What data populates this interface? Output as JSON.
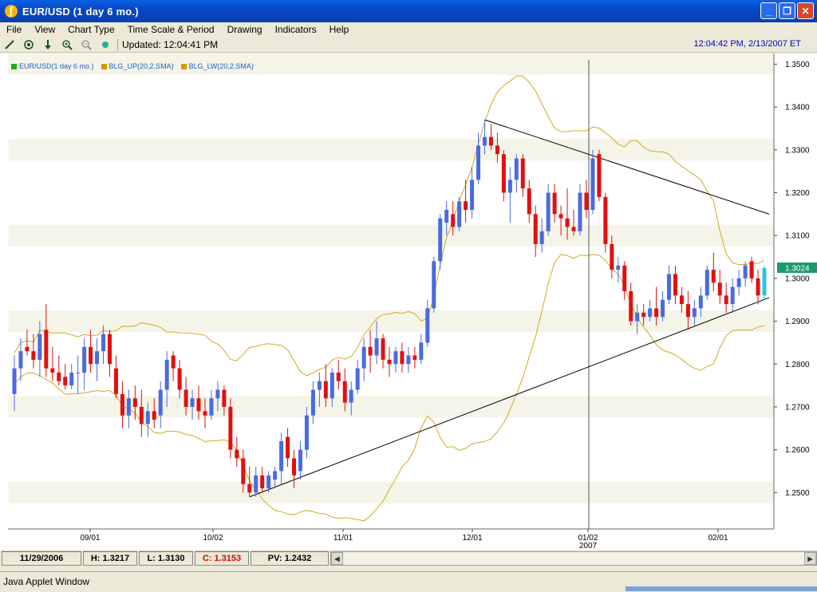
{
  "window": {
    "title": "EUR/USD (1  day  6 mo.)",
    "buttons": [
      "_",
      "❐",
      "✕"
    ]
  },
  "menu": [
    "File",
    "View",
    "Chart Type",
    "Time Scale & Period",
    "Drawing",
    "Indicators",
    "Help"
  ],
  "toolbar": {
    "icons": [
      "line-tool-icon",
      "crosshair-icon",
      "arrow-down-icon",
      "zoom-in-icon",
      "zoom-out-icon",
      "color-dot-icon"
    ],
    "updated": "Updated: 12:04:41 PM",
    "clock": "12:04:42 PM, 2/13/2007 ET"
  },
  "legend": [
    {
      "label": "EUR/USD(1 day 6 mo.)",
      "color": "#22aa22"
    },
    {
      "label": "BLG_UP(20,2,SMA)",
      "color": "#c8a000"
    },
    {
      "label": "BLG_LW(20,2,SMA)",
      "color": "#c8a000"
    }
  ],
  "status": {
    "date": "11/29/2006",
    "high": "H: 1.3217",
    "low": "L: 1.3130",
    "close": "C: 1.3153",
    "pv": "PV: 1.2432"
  },
  "java_bar": "Java Applet Window",
  "chart_data": {
    "type": "candlestick",
    "y_ticks": [
      "1.3500",
      "1.3400",
      "1.3300",
      "1.3200",
      "1.3100",
      "1.3000",
      "1.2900",
      "1.2800",
      "1.2700",
      "1.2600",
      "1.2500"
    ],
    "x_ticks": [
      "09/01",
      "10/02",
      "11/01",
      "12/01",
      "01/02",
      "02/01"
    ],
    "x_subticks": [
      "",
      "",
      "",
      "",
      "2007",
      ""
    ],
    "last_price": "1.3024",
    "ylim": [
      1.2415,
      1.3525
    ],
    "colors": {
      "up": "#4a6ae0",
      "down": "#e01010",
      "band": "#d4a820",
      "last": "#1a9a70",
      "trend": "#000000",
      "stripe": "#f5f4e8"
    },
    "candles": [
      [
        1.273,
        1.282,
        1.269,
        1.279
      ],
      [
        1.279,
        1.286,
        1.276,
        1.283
      ],
      [
        1.284,
        1.288,
        1.282,
        1.283
      ],
      [
        1.283,
        1.287,
        1.279,
        1.281
      ],
      [
        1.281,
        1.29,
        1.277,
        1.287
      ],
      [
        1.288,
        1.294,
        1.277,
        1.279
      ],
      [
        1.279,
        1.284,
        1.276,
        1.278
      ],
      [
        1.278,
        1.282,
        1.275,
        1.276
      ],
      [
        1.277,
        1.28,
        1.274,
        1.275
      ],
      [
        1.275,
        1.28,
        1.274,
        1.278
      ],
      [
        1.278,
        1.282,
        1.273,
        1.278
      ],
      [
        1.278,
        1.286,
        1.274,
        1.284
      ],
      [
        1.284,
        1.288,
        1.278,
        1.28
      ],
      [
        1.28,
        1.286,
        1.276,
        1.283
      ],
      [
        1.283,
        1.289,
        1.28,
        1.287
      ],
      [
        1.287,
        1.288,
        1.277,
        1.28
      ],
      [
        1.279,
        1.282,
        1.272,
        1.273
      ],
      [
        1.273,
        1.276,
        1.265,
        1.268
      ],
      [
        1.268,
        1.274,
        1.265,
        1.272
      ],
      [
        1.272,
        1.275,
        1.267,
        1.27
      ],
      [
        1.27,
        1.274,
        1.263,
        1.266
      ],
      [
        1.266,
        1.271,
        1.263,
        1.269
      ],
      [
        1.269,
        1.272,
        1.265,
        1.267
      ],
      [
        1.268,
        1.276,
        1.265,
        1.274
      ],
      [
        1.274,
        1.283,
        1.27,
        1.281
      ],
      [
        1.282,
        1.283,
        1.276,
        1.279
      ],
      [
        1.279,
        1.281,
        1.272,
        1.274
      ],
      [
        1.274,
        1.277,
        1.268,
        1.27
      ],
      [
        1.27,
        1.274,
        1.267,
        1.272
      ],
      [
        1.272,
        1.275,
        1.267,
        1.269
      ],
      [
        1.269,
        1.272,
        1.265,
        1.268
      ],
      [
        1.268,
        1.274,
        1.267,
        1.272
      ],
      [
        1.272,
        1.276,
        1.269,
        1.274
      ],
      [
        1.274,
        1.275,
        1.268,
        1.27
      ],
      [
        1.27,
        1.272,
        1.258,
        1.26
      ],
      [
        1.26,
        1.263,
        1.256,
        1.258
      ],
      [
        1.258,
        1.26,
        1.25,
        1.252
      ],
      [
        1.252,
        1.256,
        1.249,
        1.25
      ],
      [
        1.25,
        1.256,
        1.249,
        1.254
      ],
      [
        1.254,
        1.256,
        1.25,
        1.251
      ],
      [
        1.251,
        1.255,
        1.25,
        1.254
      ],
      [
        1.253,
        1.256,
        1.251,
        1.255
      ],
      [
        1.255,
        1.264,
        1.252,
        1.262
      ],
      [
        1.263,
        1.265,
        1.256,
        1.258
      ],
      [
        1.258,
        1.26,
        1.251,
        1.254
      ],
      [
        1.255,
        1.262,
        1.253,
        1.26
      ],
      [
        1.26,
        1.27,
        1.258,
        1.268
      ],
      [
        1.268,
        1.276,
        1.266,
        1.274
      ],
      [
        1.274,
        1.278,
        1.27,
        1.276
      ],
      [
        1.276,
        1.28,
        1.27,
        1.272
      ],
      [
        1.272,
        1.279,
        1.27,
        1.278
      ],
      [
        1.278,
        1.281,
        1.274,
        1.276
      ],
      [
        1.276,
        1.279,
        1.269,
        1.271
      ],
      [
        1.271,
        1.276,
        1.268,
        1.274
      ],
      [
        1.274,
        1.281,
        1.273,
        1.279
      ],
      [
        1.279,
        1.286,
        1.276,
        1.284
      ],
      [
        1.284,
        1.288,
        1.278,
        1.282
      ],
      [
        1.282,
        1.29,
        1.28,
        1.286
      ],
      [
        1.286,
        1.287,
        1.279,
        1.281
      ],
      [
        1.281,
        1.284,
        1.277,
        1.28
      ],
      [
        1.28,
        1.284,
        1.278,
        1.283
      ],
      [
        1.283,
        1.285,
        1.278,
        1.28
      ],
      [
        1.28,
        1.284,
        1.278,
        1.282
      ],
      [
        1.282,
        1.284,
        1.279,
        1.281
      ],
      [
        1.281,
        1.287,
        1.28,
        1.285
      ],
      [
        1.285,
        1.295,
        1.284,
        1.293
      ],
      [
        1.293,
        1.305,
        1.292,
        1.304
      ],
      [
        1.304,
        1.315,
        1.302,
        1.314
      ],
      [
        1.313,
        1.318,
        1.31,
        1.316
      ],
      [
        1.315,
        1.318,
        1.31,
        1.312
      ],
      [
        1.312,
        1.319,
        1.311,
        1.318
      ],
      [
        1.318,
        1.323,
        1.313,
        1.316
      ],
      [
        1.316,
        1.326,
        1.314,
        1.323
      ],
      [
        1.323,
        1.334,
        1.322,
        1.331
      ],
      [
        1.331,
        1.337,
        1.329,
        1.333
      ],
      [
        1.333,
        1.336,
        1.33,
        1.331
      ],
      [
        1.331,
        1.334,
        1.327,
        1.329
      ],
      [
        1.329,
        1.33,
        1.318,
        1.32
      ],
      [
        1.32,
        1.326,
        1.313,
        1.323
      ],
      [
        1.323,
        1.329,
        1.32,
        1.328
      ],
      [
        1.328,
        1.329,
        1.319,
        1.321
      ],
      [
        1.321,
        1.323,
        1.313,
        1.315
      ],
      [
        1.315,
        1.317,
        1.305,
        1.308
      ],
      [
        1.308,
        1.314,
        1.306,
        1.311
      ],
      [
        1.311,
        1.322,
        1.31,
        1.32
      ],
      [
        1.32,
        1.322,
        1.313,
        1.315
      ],
      [
        1.315,
        1.317,
        1.31,
        1.314
      ],
      [
        1.314,
        1.321,
        1.309,
        1.312
      ],
      [
        1.312,
        1.316,
        1.31,
        1.311
      ],
      [
        1.311,
        1.322,
        1.31,
        1.32
      ],
      [
        1.32,
        1.323,
        1.314,
        1.316
      ],
      [
        1.316,
        1.33,
        1.315,
        1.328
      ],
      [
        1.329,
        1.33,
        1.318,
        1.319
      ],
      [
        1.319,
        1.32,
        1.306,
        1.308
      ],
      [
        1.308,
        1.31,
        1.3,
        1.302
      ],
      [
        1.302,
        1.305,
        1.299,
        1.303
      ],
      [
        1.303,
        1.304,
        1.295,
        1.297
      ],
      [
        1.297,
        1.299,
        1.289,
        1.29
      ],
      [
        1.29,
        1.294,
        1.287,
        1.292
      ],
      [
        1.292,
        1.294,
        1.289,
        1.291
      ],
      [
        1.291,
        1.295,
        1.29,
        1.293
      ],
      [
        1.293,
        1.298,
        1.289,
        1.291
      ],
      [
        1.291,
        1.297,
        1.29,
        1.295
      ],
      [
        1.295,
        1.303,
        1.294,
        1.301
      ],
      [
        1.301,
        1.303,
        1.294,
        1.296
      ],
      [
        1.296,
        1.298,
        1.292,
        1.294
      ],
      [
        1.294,
        1.297,
        1.288,
        1.291
      ],
      [
        1.291,
        1.295,
        1.289,
        1.293
      ],
      [
        1.293,
        1.298,
        1.291,
        1.296
      ],
      [
        1.296,
        1.303,
        1.295,
        1.302
      ],
      [
        1.302,
        1.306,
        1.297,
        1.299
      ],
      [
        1.299,
        1.302,
        1.294,
        1.296
      ],
      [
        1.296,
        1.299,
        1.292,
        1.294
      ],
      [
        1.294,
        1.3,
        1.292,
        1.298
      ],
      [
        1.298,
        1.302,
        1.296,
        1.3
      ],
      [
        1.3,
        1.304,
        1.298,
        1.303
      ],
      [
        1.304,
        1.305,
        1.299,
        1.3
      ],
      [
        1.3,
        1.302,
        1.294,
        1.296
      ],
      [
        1.296,
        1.303,
        1.295,
        1.3024
      ]
    ]
  }
}
